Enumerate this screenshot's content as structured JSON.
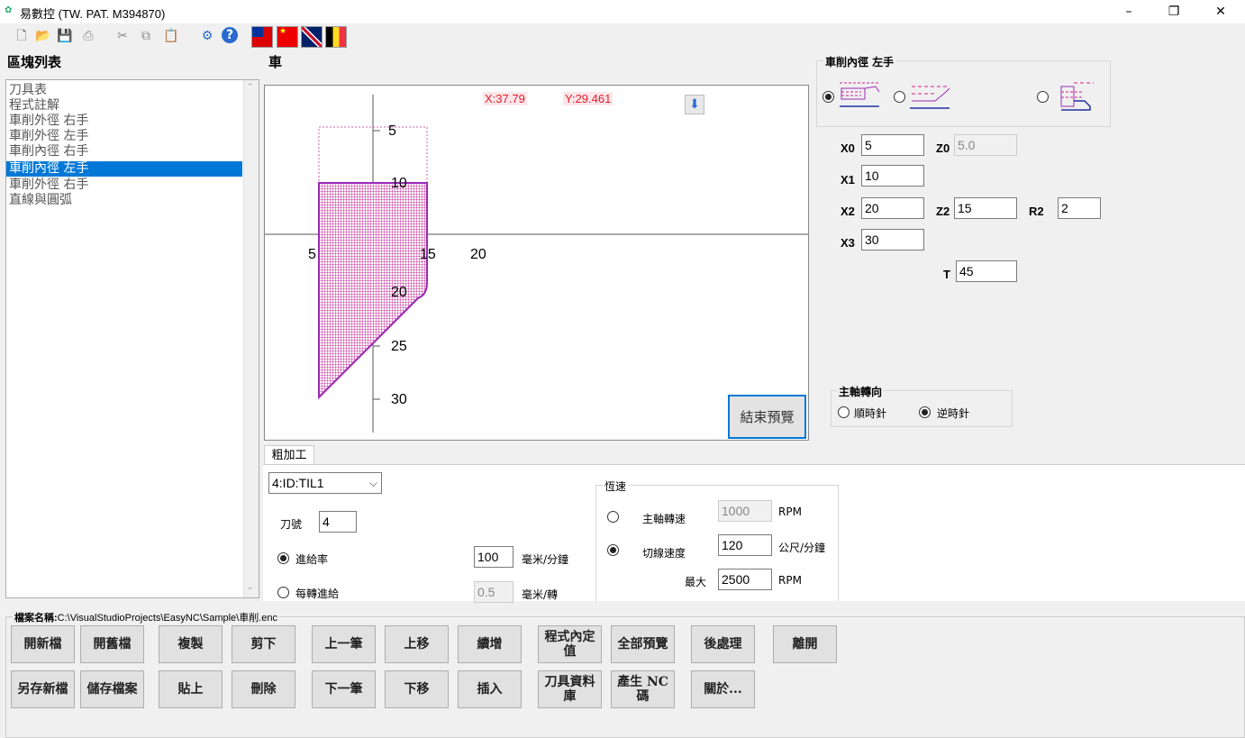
{
  "window": {
    "icon": "app-logo-icon",
    "title": "易數控 (TW. PAT. M394870)",
    "min": "–",
    "restore": "❐",
    "close": "✕"
  },
  "toolbar": {
    "icons": [
      "new-file-icon",
      "open-folder-icon",
      "save-icon",
      "print-icon",
      "cut-icon",
      "copy-icon",
      "paste-icon",
      "settings-icon",
      "help-icon"
    ],
    "flags": [
      "taiwan-flag-icon",
      "china-flag-icon",
      "uk-flag-icon",
      "belgium-flag-icon"
    ]
  },
  "left": {
    "header": "區塊列表",
    "items": [
      "刀具表",
      "程式註解",
      "車削外徑 右手",
      "車削外徑 左手",
      "車削內徑 右手",
      "車削內徑 左手",
      "車削外徑 右手",
      "直線與圓弧"
    ],
    "selected_index": 5
  },
  "canvas": {
    "header": "車",
    "x_readout": "X:37.79",
    "y_readout": "Y:29.461",
    "download_glyph": "⬇",
    "end_preview": "結束預覽",
    "x_ticks": [
      "5",
      "15",
      "20"
    ],
    "y_ticks": [
      "5",
      "10",
      "20",
      "25",
      "30"
    ]
  },
  "right": {
    "group_title": "車削內徑 左手",
    "option_selected": 0,
    "fields": {
      "X0_label": "X0",
      "X0": "5",
      "Z0_label": "Z0",
      "Z0": "5.0",
      "X1_label": "X1",
      "X1": "10",
      "X2_label": "X2",
      "X2": "20",
      "Z2_label": "Z2",
      "Z2": "15",
      "R2_label": "R2",
      "R2": "2",
      "X3_label": "X3",
      "X3": "30",
      "T_label": "T",
      "T": "45"
    },
    "spindle": {
      "title": "主軸轉向",
      "cw": "順時針",
      "ccw": "逆時針",
      "selected": "ccw"
    }
  },
  "tab": {
    "label": "粗加工",
    "tool_select": "4:ID:TIL1",
    "tool_no_label": "刀號",
    "tool_no": "4",
    "feed_label": "進給率",
    "feed_value": "100",
    "feed_unit": "毫米/分鐘",
    "per_rev_label": "每轉進給",
    "per_rev_value": "0.5",
    "per_rev_unit": "毫米/轉",
    "speed_group": "恆速",
    "spindle_speed_label": "主軸轉速",
    "spindle_speed": "1000",
    "rpm1": "RPM",
    "surface_label": "切線速度",
    "surface_value": "120",
    "surface_unit": "公尺/分鐘",
    "max_label": "最大",
    "max_value": "2500",
    "rpm2": "RPM",
    "mode": "surface",
    "feed_mode": "feed"
  },
  "footer": {
    "file_label": "檔案名稱:",
    "file_path": "C:\\VisualStudioProjects\\EasyNC\\Sample\\車削.enc",
    "buttons_row1": [
      "開新檔",
      "開舊檔",
      "複製",
      "剪下",
      "上一筆",
      "上移",
      "續增",
      "程式內定值",
      "全部預覽",
      "後處理",
      "離開"
    ],
    "buttons_row2": [
      "另存新檔",
      "儲存檔案",
      "貼上",
      "刪除",
      "下一筆",
      "下移",
      "插入",
      "刀具資料庫",
      "產生 NC 碼",
      "關於..."
    ]
  },
  "colors": {
    "accent": "#0078d7",
    "profile": "#9b2ab8",
    "hatch": "#c0309a",
    "readout": "#e0202a"
  }
}
